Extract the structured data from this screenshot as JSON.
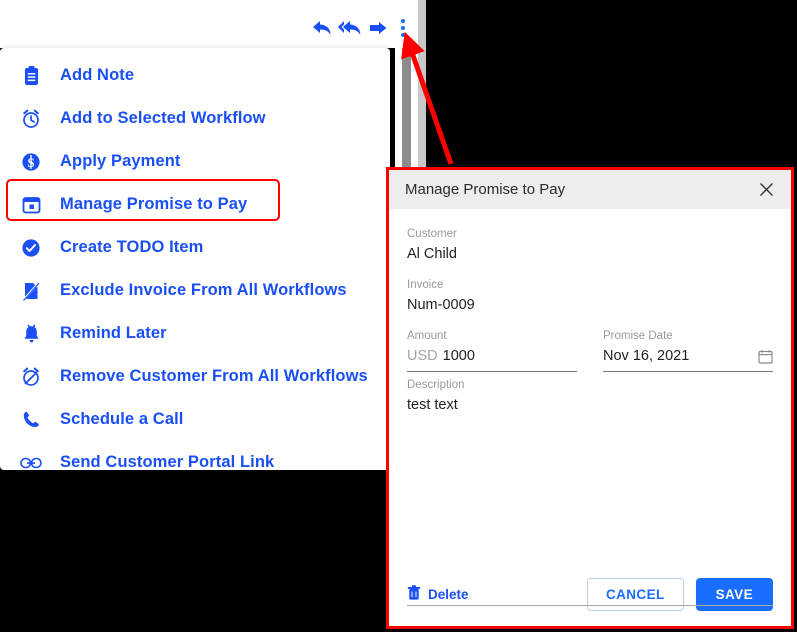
{
  "toolbar": {
    "buttons": [
      {
        "name": "reply-icon",
        "label": "Reply"
      },
      {
        "name": "reply-all-icon",
        "label": "Reply All"
      },
      {
        "name": "forward-icon",
        "label": "Forward"
      },
      {
        "name": "more-options-kebab-icon",
        "label": "More options"
      }
    ]
  },
  "menu": {
    "items": [
      {
        "icon": "note-icon",
        "label": "Add Note"
      },
      {
        "icon": "alarm-clock-icon",
        "label": "Add to Selected Workflow"
      },
      {
        "icon": "dollar-circle-icon",
        "label": "Apply Payment"
      },
      {
        "icon": "calendar-icon",
        "label": "Manage Promise to Pay"
      },
      {
        "icon": "check-circle-icon",
        "label": "Create TODO Item"
      },
      {
        "icon": "document-slash-icon",
        "label": "Exclude Invoice From All Workflows"
      },
      {
        "icon": "bell-icon",
        "label": "Remind Later"
      },
      {
        "icon": "alarm-off-icon",
        "label": "Remove Customer From All Workflows"
      },
      {
        "icon": "phone-icon",
        "label": "Schedule a Call"
      },
      {
        "icon": "link-icon",
        "label": "Send Customer Portal Link"
      }
    ],
    "highlighted_index": 3
  },
  "dialog": {
    "title": "Manage Promise to Pay",
    "close_label": "✕",
    "fields": {
      "customer": {
        "label": "Customer",
        "value": "Al Child"
      },
      "invoice": {
        "label": "Invoice",
        "value": "Num-0009"
      },
      "amount": {
        "label": "Amount",
        "prefix": "USD",
        "value": "1000"
      },
      "promise_date": {
        "label": "Promise Date",
        "value": "Nov 16, 2021",
        "icon": "calendar-picker-icon"
      },
      "description": {
        "label": "Description",
        "value": "test text"
      }
    },
    "footer": {
      "delete_label": "Delete",
      "delete_icon": "trash-icon",
      "cancel_label": "CANCEL",
      "save_label": "SAVE"
    }
  },
  "annotation": {
    "arrow": "red-pointer-arrow",
    "highlight_color": "#ff0000"
  },
  "colors": {
    "accent_blue": "#1a4ff5",
    "button_blue": "#1a6eff",
    "annotation_red": "#ff0000",
    "header_gray": "#ededed"
  }
}
